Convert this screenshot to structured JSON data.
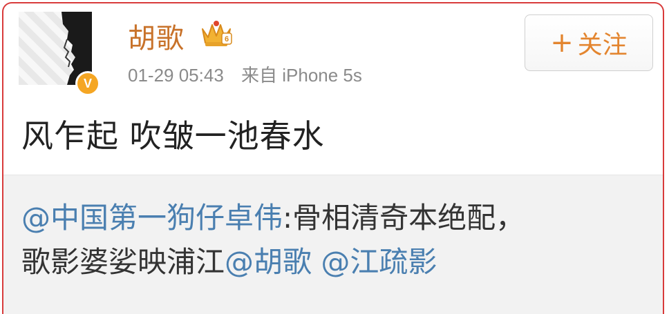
{
  "post": {
    "username": "胡歌",
    "timestamp": "01-29 05:43",
    "source": "来自 iPhone 5s",
    "follow_label": "关注",
    "follow_plus": "+",
    "text": "风乍起 吹皱一池春水",
    "verified_badge": "V",
    "icons": {
      "avatar": "avatar",
      "verified": "verified-icon",
      "member_crown": "crown-icon"
    }
  },
  "repost": {
    "mention_1": "@中国第一狗仔卓伟",
    "text_1": ":骨相清奇本绝配，",
    "text_2": "歌影婆娑映浦江",
    "mention_2": "@胡歌",
    "space": " ",
    "mention_3": "@江疏影"
  },
  "colors": {
    "username": "#c8722a",
    "mention": "#4a7fb0",
    "follow": "#e3852f",
    "verified": "#f5a623",
    "frame_border": "#d83a3a",
    "repost_bg": "#f2f2f2"
  }
}
